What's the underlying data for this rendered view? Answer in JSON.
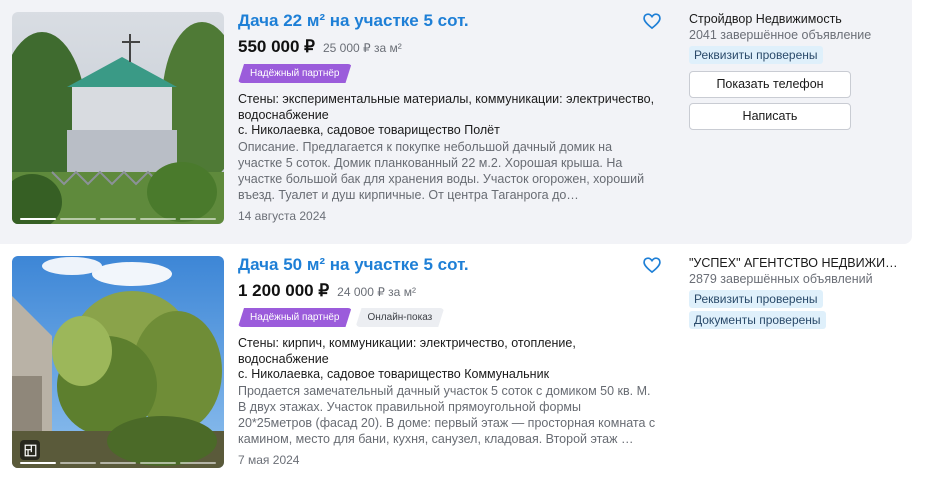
{
  "listings": [
    {
      "title": "Дача 22 м² на участке 5 сот.",
      "price": "550 000 ₽",
      "price_per_m2": "25 000 ₽ за м²",
      "badges": [
        "Надёжный партнёр"
      ],
      "walls_comms": "Стены: экспериментальные материалы, коммуникации: электричество, водоснабжение",
      "address": "с. Николаевка, садовое товарищество Полёт",
      "description": "Описание. Предлагается к покупке небольшой дачный домик на участке 5 соток. Домик планкованный 22 м.2. Хорошая крыша. На участке большой бак для хранения воды. Участок огорожен, хороший въезд. Туалет и душ кирпичные. От центра Таганрога до…",
      "date": "14 августа 2024",
      "seller": {
        "name": "Стройдвор Недвижимость",
        "deals": "2041 завершённое объявление",
        "checks": [
          "Реквизиты проверены"
        ],
        "phone_button": "Показать телефон",
        "message_button": "Написать"
      },
      "favorite_icon": "heart-outline-icon"
    },
    {
      "title": "Дача 50 м² на участке 5 сот.",
      "price": "1 200 000 ₽",
      "price_per_m2": "24 000 ₽ за м²",
      "badges": [
        "Надёжный партнёр",
        "Онлайн-показ"
      ],
      "walls_comms": "Стены: кирпич, коммуникации: электричество, отопление, водоснабжение",
      "address": "с. Николаевка, садовое товарищество Коммунальник",
      "description": "Продается замечательный дачный участок 5 соток с домиком 50 кв. М. В двух этажах. Участок правильной прямоугольной формы 20*25метров (фасад 20). В доме: первый этаж — просторная комната с камином, место для бани, кухня, санузел, кладовая. Второй этаж …",
      "date": "7 мая 2024",
      "seller": {
        "name": "\"УСПЕХ\" АГЕНТСТВО НЕДВИЖИ…",
        "deals": "2879 завершённых объявлений",
        "checks": [
          "Реквизиты проверены",
          "Документы проверены"
        ]
      },
      "favorite_icon": "heart-outline-icon",
      "photo_badge_icon": "floor-plan-icon"
    }
  ],
  "colors": {
    "title_link": "#1e7fd6",
    "partner_badge": "#9b5cdb",
    "verified_bg": "#dff0fb",
    "highlight_bg": "#f2f3f7"
  }
}
